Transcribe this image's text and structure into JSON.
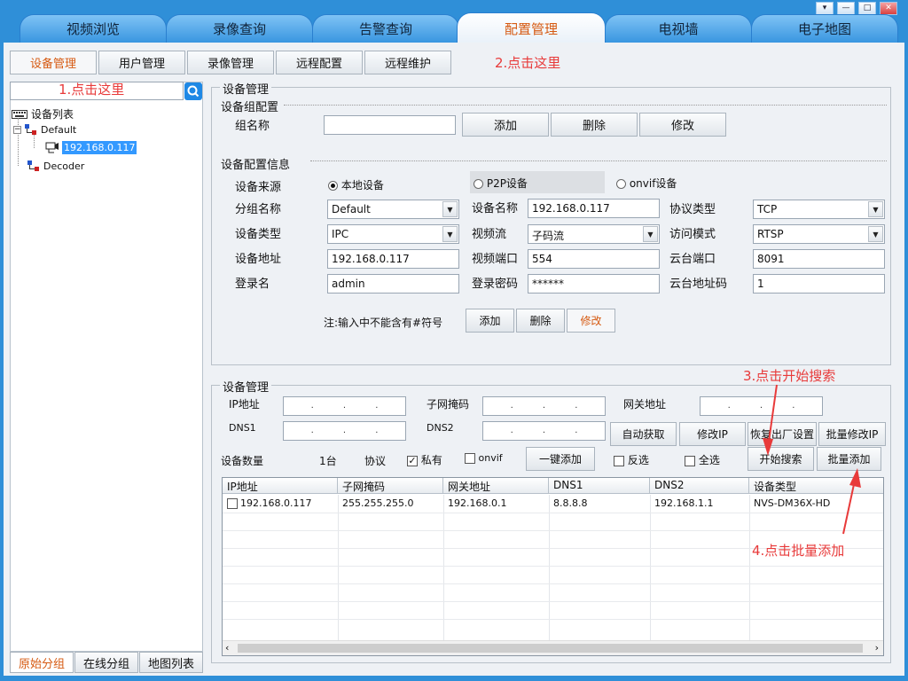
{
  "main_tabs": [
    "视频浏览",
    "录像查询",
    "告警查询",
    "配置管理",
    "电视墙",
    "电子地图"
  ],
  "window_controls": [
    "▾",
    "—",
    "□",
    "✕"
  ],
  "sub_tabs": [
    "设备管理",
    "用户管理",
    "录像管理",
    "远程配置",
    "远程维护"
  ],
  "annotations": {
    "a1": "1.点击这里",
    "a2": "2.点击这里",
    "a3": "3.点击开始搜索",
    "a4": "4.点击批量添加"
  },
  "tree": {
    "root": "设备列表",
    "group_default": "Default",
    "device": "192.168.0.117",
    "group_decoder": "Decoder"
  },
  "bottom_tabs": [
    "原始分组",
    "在线分组",
    "地图列表"
  ],
  "device_mgmt": {
    "title": "设备管理",
    "group_config": {
      "title": "设备组配置",
      "group_name_label": "组名称",
      "group_name_value": "",
      "buttons": [
        "添加",
        "删除",
        "修改"
      ]
    },
    "device_info": {
      "title": "设备配置信息",
      "source_label": "设备来源",
      "sources": [
        "本地设备",
        "P2P设备",
        "onvif设备"
      ],
      "selected_source": "本地设备",
      "fields": {
        "group_label": "分组名称",
        "group_value": "Default",
        "name_label": "设备名称",
        "name_value": "192.168.0.117",
        "protocol_label": "协议类型",
        "protocol_value": "TCP",
        "type_label": "设备类型",
        "type_value": "IPC",
        "stream_label": "视频流",
        "stream_value": "子码流",
        "access_label": "访问模式",
        "access_value": "RTSP",
        "addr_label": "设备地址",
        "addr_value": "192.168.0.117",
        "vport_label": "视频端口",
        "vport_value": "554",
        "ptzport_label": "云台端口",
        "ptzport_value": "8091",
        "login_label": "登录名",
        "login_value": "admin",
        "pwd_label": "登录密码",
        "pwd_value": "******",
        "ptzaddr_label": "云台地址码",
        "ptzaddr_value": "1"
      },
      "note": "注:输入中不能含有#符号",
      "buttons": [
        "添加",
        "删除",
        "修改"
      ]
    }
  },
  "search_mgmt": {
    "title": "设备管理",
    "ip_label": "IP地址",
    "mask_label": "子网掩码",
    "gateway_label": "网关地址",
    "dns1_label": "DNS1",
    "dns2_label": "DNS2",
    "ip_placeholder_dots": [
      ".",
      ".",
      "."
    ],
    "buttons_row1": [
      "自动获取",
      "修改IP",
      "恢复出厂设置",
      "批量修改IP"
    ],
    "count_label": "设备数量",
    "count_value": "1台",
    "protocol_label": "协议",
    "private_label": "私有",
    "onvif_label": "onvif",
    "one_key_add": "一键添加",
    "invert_label": "反选",
    "select_all_label": "全选",
    "start_search": "开始搜索",
    "batch_add": "批量添加"
  },
  "table": {
    "headers": [
      "IP地址",
      "子网掩码",
      "网关地址",
      "DNS1",
      "DNS2",
      "设备类型"
    ],
    "rows": [
      [
        "192.168.0.117",
        "255.255.255.0",
        "192.168.0.1",
        "8.8.8.8",
        "192.168.1.1",
        "NVS-DM36X-HD"
      ]
    ]
  },
  "colors": {
    "frame": "#2f8fd8",
    "panel": "#eef1f5",
    "active_text": "#d65a12",
    "annotation": "#e83a3a",
    "selection": "#3399ff"
  }
}
